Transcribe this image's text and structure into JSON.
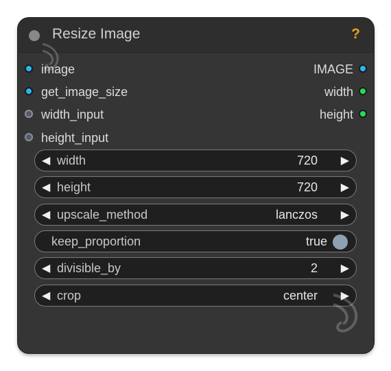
{
  "node": {
    "title": "Resize Image",
    "help_label": "?",
    "inputs": [
      {
        "label": "image",
        "type": "blue"
      },
      {
        "label": "get_image_size",
        "type": "blue-ring"
      },
      {
        "label": "width_input",
        "type": "gray"
      },
      {
        "label": "height_input",
        "type": "gray"
      }
    ],
    "outputs": [
      {
        "label": "IMAGE",
        "type": "blue"
      },
      {
        "label": "width",
        "type": "green"
      },
      {
        "label": "height",
        "type": "green"
      }
    ],
    "widgets": {
      "width": {
        "label": "width",
        "value": "720"
      },
      "height": {
        "label": "height",
        "value": "720"
      },
      "upscale_method": {
        "label": "upscale_method",
        "value": "lanczos"
      },
      "keep_proportion": {
        "label": "keep_proportion",
        "value": "true"
      },
      "divisible_by": {
        "label": "divisible_by",
        "value": "2"
      },
      "crop": {
        "label": "crop",
        "value": "center"
      }
    }
  },
  "colors": {
    "node_bg": "#353535",
    "title_bg": "#2e2e2e",
    "help": "#e8a020",
    "slot_blue": "#29b6f6",
    "slot_green": "#22dd55",
    "toggle_on": "#8fa0b3"
  },
  "icons": {
    "left_arrow": "◀",
    "right_arrow": "▶"
  }
}
